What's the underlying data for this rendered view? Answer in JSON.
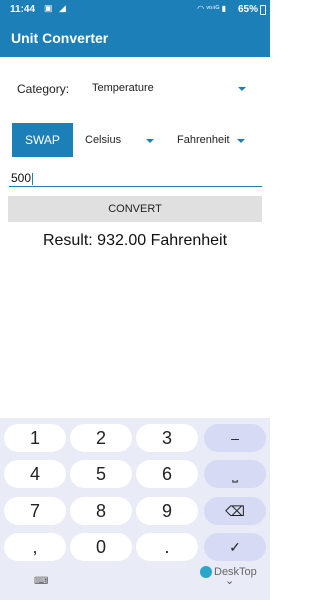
{
  "status": {
    "time": "11:44",
    "notification_icons": "▣ ◢",
    "system_icons": "◠ ᵛᵒ⁴ᴳ ▮",
    "battery": "65%"
  },
  "app": {
    "title": "Unit Converter"
  },
  "category": {
    "label": "Category:",
    "value": "Temperature"
  },
  "swap_label": "SWAP",
  "from_unit": "Celsius",
  "to_unit": "Fahrenheit",
  "input": {
    "value": "500"
  },
  "convert_label": "CONVERT",
  "result_text": "Result: 932.00 Fahrenheit",
  "keyboard": {
    "keys": [
      "1",
      "2",
      "3",
      "–",
      "4",
      "5",
      "6",
      "⎵",
      "7",
      "8",
      "9",
      "⌫",
      ",",
      "0",
      ".",
      "✓"
    ]
  },
  "watermark": "DeskTop",
  "colors": {
    "accent": "#1d7fb8",
    "keyboard_bg": "#e9ebf6",
    "fn_key": "#d6daf4"
  }
}
